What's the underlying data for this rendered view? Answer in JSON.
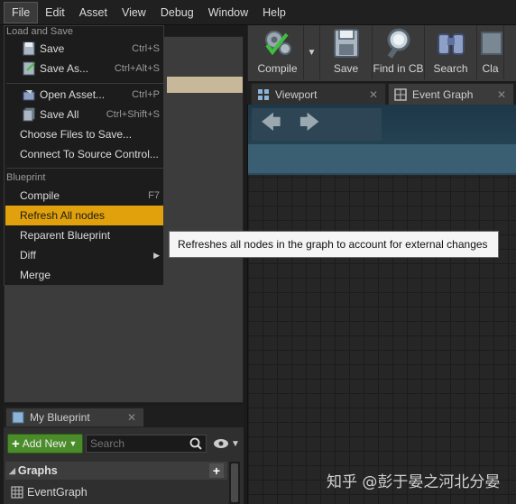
{
  "menubar": {
    "items": [
      "File",
      "Edit",
      "Asset",
      "View",
      "Debug",
      "Window",
      "Help"
    ]
  },
  "toolbar": {
    "buttons": [
      {
        "label": "Compile",
        "icon": "compile-icon"
      },
      {
        "label": "Save",
        "icon": "save-disk-icon"
      },
      {
        "label": "Find in CB",
        "icon": "magnifier-icon"
      },
      {
        "label": "Search",
        "icon": "binoculars-icon"
      },
      {
        "label": "Cla",
        "icon": "class-settings-icon"
      }
    ]
  },
  "tabs": [
    {
      "label": "Viewport"
    },
    {
      "label": "Event Graph"
    }
  ],
  "file_menu": {
    "section_load_save": "Load and Save",
    "save": {
      "label": "Save",
      "shortcut": "Ctrl+S"
    },
    "save_as": {
      "label": "Save As...",
      "shortcut": "Ctrl+Alt+S"
    },
    "open_asset": {
      "label": "Open Asset...",
      "shortcut": "Ctrl+P"
    },
    "save_all": {
      "label": "Save All",
      "shortcut": "Ctrl+Shift+S"
    },
    "choose_files": {
      "label": "Choose Files to Save..."
    },
    "connect_source": {
      "label": "Connect To Source Control..."
    },
    "section_blueprint": "Blueprint",
    "compile": {
      "label": "Compile",
      "shortcut": "F7"
    },
    "refresh_all": {
      "label": "Refresh All nodes"
    },
    "reparent": {
      "label": "Reparent Blueprint"
    },
    "diff": {
      "label": "Diff"
    },
    "merge": {
      "label": "Merge"
    }
  },
  "tooltip": {
    "text": "Refreshes all nodes in the graph to account for external changes"
  },
  "my_blueprint": {
    "tab_label": "My Blueprint",
    "add_new_label": "Add New",
    "search_placeholder": "Search",
    "graphs_label": "Graphs",
    "event_graph_label": "EventGraph"
  },
  "watermark": "知乎 @彭于晏之河北分晏",
  "colors": {
    "highlight": "#e0a10c",
    "add_new_green": "#4a8c2a",
    "graph_header": "#3a5f72"
  }
}
